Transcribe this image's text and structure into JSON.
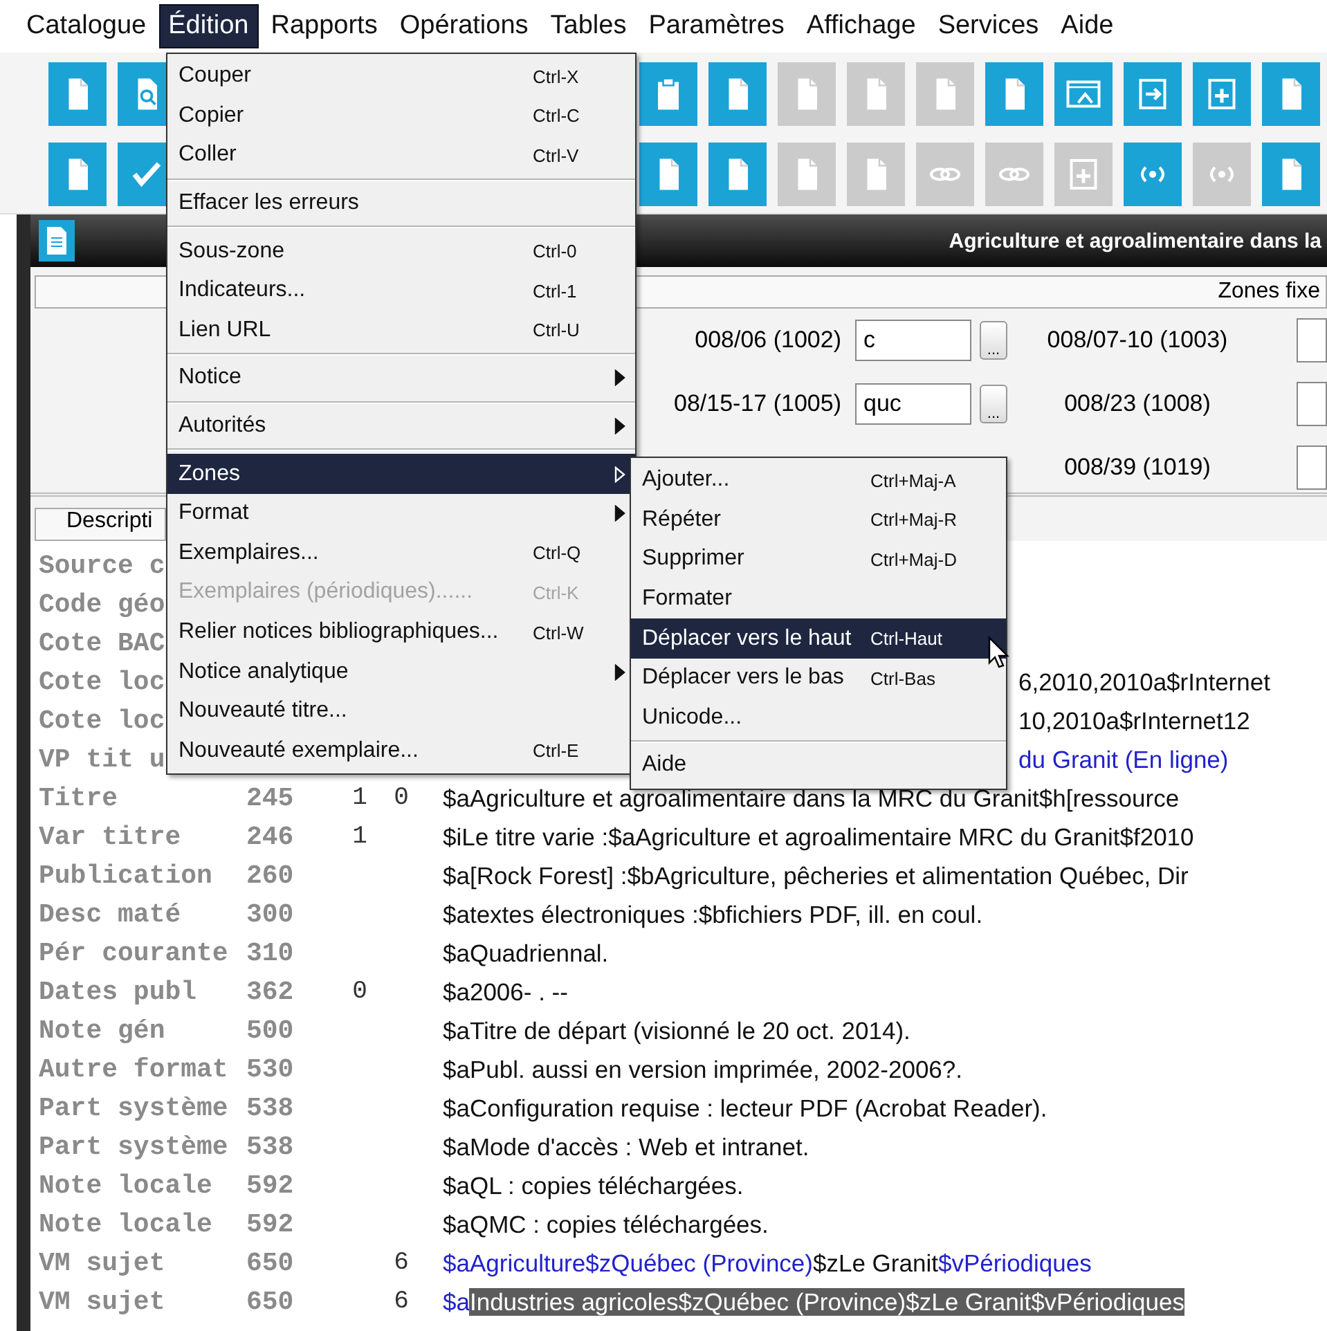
{
  "menubar": [
    {
      "label": "Catalogue",
      "selected": false
    },
    {
      "label": "Édition",
      "selected": true
    },
    {
      "label": "Rapports",
      "selected": false
    },
    {
      "label": "Opérations",
      "selected": false
    },
    {
      "label": "Tables",
      "selected": false
    },
    {
      "label": "Paramètres",
      "selected": false
    },
    {
      "label": "Affichage",
      "selected": false
    },
    {
      "label": "Services",
      "selected": false
    },
    {
      "label": "Aide",
      "selected": false
    }
  ],
  "toolbar": {
    "rows": [
      {
        "left": [
          {
            "kind": "document",
            "disabled": false
          },
          {
            "kind": "search",
            "disabled": false
          }
        ],
        "right": [
          {
            "kind": "clipboard",
            "disabled": false
          },
          {
            "kind": "document",
            "disabled": false
          },
          {
            "kind": "document",
            "disabled": true
          },
          {
            "kind": "document",
            "disabled": true
          },
          {
            "kind": "document",
            "disabled": true
          },
          {
            "kind": "document",
            "disabled": false
          },
          {
            "kind": "window",
            "disabled": false
          },
          {
            "kind": "arrow",
            "disabled": false
          },
          {
            "kind": "plus",
            "disabled": false
          },
          {
            "kind": "document",
            "disabled": false
          }
        ]
      },
      {
        "left": [
          {
            "kind": "document",
            "disabled": false
          },
          {
            "kind": "check",
            "disabled": false
          }
        ],
        "right": [
          {
            "kind": "document",
            "disabled": false
          },
          {
            "kind": "document",
            "disabled": false
          },
          {
            "kind": "document",
            "disabled": true
          },
          {
            "kind": "document",
            "disabled": true
          },
          {
            "kind": "link",
            "disabled": true
          },
          {
            "kind": "link",
            "disabled": true
          },
          {
            "kind": "plus",
            "disabled": true
          },
          {
            "kind": "brackets",
            "disabled": false
          },
          {
            "kind": "brackets",
            "disabled": true
          },
          {
            "kind": "document",
            "disabled": false
          }
        ]
      }
    ]
  },
  "record_window": {
    "title": "Agriculture et agroalimentaire dans la",
    "fixed_fields": {
      "heading": "Zones fixe",
      "rows": [
        {
          "label": "008/06 (1002)",
          "value": "c",
          "button": "...",
          "label_2": "008/07-10 (1003)"
        },
        {
          "label": "08/15-17 (1005)",
          "value": "quc",
          "button": "...",
          "label_2": "008/23 (1008)"
        },
        {
          "label_2": "008/39 (1019)"
        }
      ]
    },
    "tab": "Descripti",
    "fields": [
      {
        "label": "Source c"
      },
      {
        "label": "Code géo"
      },
      {
        "label": "Cote BAC"
      },
      {
        "label": "Cote loc",
        "parts": [
          {
            "text": "6,2010,2010a$rInternet",
            "kind": "plain"
          }
        ]
      },
      {
        "label": "Cote loc",
        "parts": [
          {
            "text": "10,2010a$rInternet12",
            "kind": "plain"
          }
        ]
      },
      {
        "label": "VP tit u",
        "parts": [
          {
            "text": "du Granit (En ligne)",
            "kind": "linked"
          }
        ]
      },
      {
        "label": "Titre",
        "tag": "245",
        "ind1": "1",
        "ind2": "0",
        "parts": [
          {
            "text": "$aAgriculture et agroalimentaire dans la MRC du Granit$h[ressource",
            "kind": "plain"
          }
        ]
      },
      {
        "label": "Var titre",
        "tag": "246",
        "ind1": "1",
        "parts": [
          {
            "text": "$iLe titre varie :$aAgriculture et agroalimentaire MRC du Granit$f2010",
            "kind": "plain"
          }
        ]
      },
      {
        "label": "Publication",
        "tag": "260",
        "parts": [
          {
            "text": "$a[Rock Forest] :$bAgriculture, pêcheries et alimentation Québec, Dir",
            "kind": "plain"
          }
        ]
      },
      {
        "label": "Desc maté",
        "tag": "300",
        "parts": [
          {
            "text": "$atextes électroniques :$bfichiers PDF, ill. en coul.",
            "kind": "plain"
          }
        ]
      },
      {
        "label": "Pér courante",
        "tag": "310",
        "parts": [
          {
            "text": "$aQuadriennal.",
            "kind": "plain"
          }
        ]
      },
      {
        "label": "Dates publ",
        "tag": "362",
        "ind1": "0",
        "parts": [
          {
            "text": "$a2006- . --",
            "kind": "plain"
          }
        ]
      },
      {
        "label": "Note gén",
        "tag": "500",
        "parts": [
          {
            "text": "$aTitre de départ (visionné le 20 oct. 2014).",
            "kind": "plain"
          }
        ]
      },
      {
        "label": "Autre format",
        "tag": "530",
        "parts": [
          {
            "text": "$aPubl. aussi en version imprimée, 2002-2006?.",
            "kind": "plain"
          }
        ]
      },
      {
        "label": "Part système",
        "tag": "538",
        "parts": [
          {
            "text": "$aConfiguration requise : lecteur PDF (Acrobat Reader).",
            "kind": "plain"
          }
        ]
      },
      {
        "label": "Part système",
        "tag": "538",
        "parts": [
          {
            "text": "$aMode d'accès : Web et intranet.",
            "kind": "plain"
          }
        ]
      },
      {
        "label": "Note locale",
        "tag": "592",
        "parts": [
          {
            "text": "$aQL : copies téléchargées.",
            "kind": "plain"
          }
        ]
      },
      {
        "label": "Note locale",
        "tag": "592",
        "parts": [
          {
            "text": "$aQMC : copies téléchargées.",
            "kind": "plain"
          }
        ]
      },
      {
        "label": "VM sujet",
        "tag": "650",
        "ind2": "6",
        "parts": [
          {
            "text": "$aAgriculture$zQuébec (Province)",
            "kind": "linked"
          },
          {
            "text": "$zLe Granit",
            "kind": "plain"
          },
          {
            "text": "$vPériodiques",
            "kind": "linked"
          }
        ]
      },
      {
        "label": "VM sujet",
        "tag": "650",
        "ind2": "6",
        "parts": [
          {
            "text": "$a",
            "kind": "linked"
          },
          {
            "text": "Industries agricoles$zQuébec (Province)$zLe Granit$vPériodiques",
            "kind": "selected"
          }
        ]
      }
    ]
  },
  "edit_menu": {
    "items": [
      {
        "kind": "command",
        "label": "Couper",
        "shortcut": "Ctrl-X",
        "selected": false,
        "disabled": false,
        "submenu": false
      },
      {
        "kind": "command",
        "label": "Copier",
        "shortcut": "Ctrl-C",
        "selected": false,
        "disabled": false,
        "submenu": false
      },
      {
        "kind": "command",
        "label": "Coller",
        "shortcut": "Ctrl-V",
        "selected": false,
        "disabled": false,
        "submenu": false
      },
      {
        "kind": "separator"
      },
      {
        "kind": "command",
        "label": "Effacer les erreurs",
        "selected": false,
        "disabled": false,
        "submenu": false
      },
      {
        "kind": "separator"
      },
      {
        "kind": "command",
        "label": "Sous-zone",
        "shortcut": "Ctrl-0",
        "selected": false,
        "disabled": false,
        "submenu": false
      },
      {
        "kind": "command",
        "label": "Indicateurs...",
        "shortcut": "Ctrl-1",
        "selected": false,
        "disabled": false,
        "submenu": false
      },
      {
        "kind": "command",
        "label": "Lien URL",
        "shortcut": "Ctrl-U",
        "selected": false,
        "disabled": false,
        "submenu": false
      },
      {
        "kind": "separator"
      },
      {
        "kind": "command",
        "label": "Notice",
        "selected": false,
        "disabled": false,
        "submenu": true
      },
      {
        "kind": "separator"
      },
      {
        "kind": "command",
        "label": "Autorités",
        "selected": false,
        "disabled": false,
        "submenu": true
      },
      {
        "kind": "separator"
      },
      {
        "kind": "command",
        "label": "Zones",
        "selected": true,
        "disabled": false,
        "submenu": true
      },
      {
        "kind": "command",
        "label": "Format",
        "selected": false,
        "disabled": false,
        "submenu": true
      },
      {
        "kind": "command",
        "label": "Exemplaires...",
        "shortcut": "Ctrl-Q",
        "selected": false,
        "disabled": false,
        "submenu": false
      },
      {
        "kind": "command",
        "label": "Exemplaires (périodiques)......",
        "shortcut": "Ctrl-K",
        "selected": false,
        "disabled": true,
        "submenu": false
      },
      {
        "kind": "command",
        "label": "Relier notices bibliographiques...",
        "shortcut": "Ctrl-W",
        "selected": false,
        "disabled": false,
        "submenu": false
      },
      {
        "kind": "command",
        "label": "Notice analytique",
        "selected": false,
        "disabled": false,
        "submenu": true
      },
      {
        "kind": "command",
        "label": "Nouveauté titre...",
        "selected": false,
        "disabled": false,
        "submenu": false
      },
      {
        "kind": "command",
        "label": "Nouveauté exemplaire...",
        "shortcut": "Ctrl-E",
        "selected": false,
        "disabled": false,
        "submenu": false
      }
    ]
  },
  "zones_submenu": {
    "items": [
      {
        "kind": "command",
        "label": "Ajouter...",
        "shortcut": "Ctrl+Maj-A",
        "selected": false,
        "disabled": false,
        "submenu": false
      },
      {
        "kind": "command",
        "label": "Répéter",
        "shortcut": "Ctrl+Maj-R",
        "selected": false,
        "disabled": false,
        "submenu": false
      },
      {
        "kind": "command",
        "label": "Supprimer",
        "shortcut": "Ctrl+Maj-D",
        "selected": false,
        "disabled": false,
        "submenu": false
      },
      {
        "kind": "command",
        "label": "Formater",
        "selected": false,
        "disabled": false,
        "submenu": false
      },
      {
        "kind": "command",
        "label": "Déplacer vers le haut",
        "shortcut": "Ctrl-Haut",
        "selected": true,
        "disabled": false,
        "submenu": false
      },
      {
        "kind": "command",
        "label": "Déplacer vers le bas",
        "shortcut": "Ctrl-Bas",
        "selected": false,
        "disabled": false,
        "submenu": false
      },
      {
        "kind": "command",
        "label": "Unicode...",
        "selected": false,
        "disabled": false,
        "submenu": false
      },
      {
        "kind": "separator"
      },
      {
        "kind": "command",
        "label": "Aide",
        "selected": false,
        "disabled": false,
        "submenu": false
      }
    ]
  }
}
